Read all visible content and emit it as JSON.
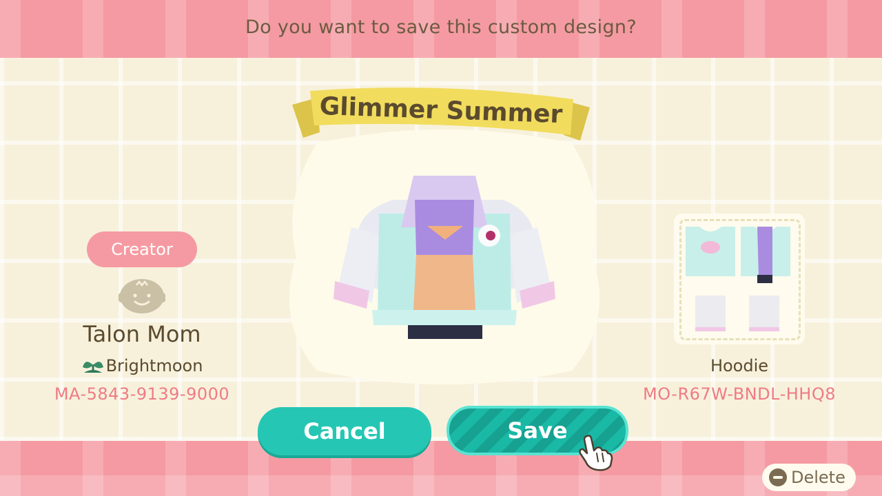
{
  "prompt": {
    "question": "Do you want to save this custom design?"
  },
  "design": {
    "title": "Glimmer Summer",
    "type": "Hoodie",
    "code": "MO-R67W-BNDL-HHQ8"
  },
  "creator": {
    "badge": "Creator",
    "name": "Talon Mom",
    "island": "Brightmoon",
    "code": "MA-5843-9139-9000",
    "avatar_icon": "villager-face-icon",
    "island_icon": "sprout-icon"
  },
  "buttons": {
    "cancel": "Cancel",
    "save": "Save",
    "delete": "Delete"
  },
  "cursor_icon": "pointing-hand-icon",
  "colors": {
    "accent": "#25c7b4",
    "pink": "#f59aa2",
    "code_pink": "#ef7b84",
    "banner": "#f2dc5d",
    "text": "#5a4a2e"
  }
}
